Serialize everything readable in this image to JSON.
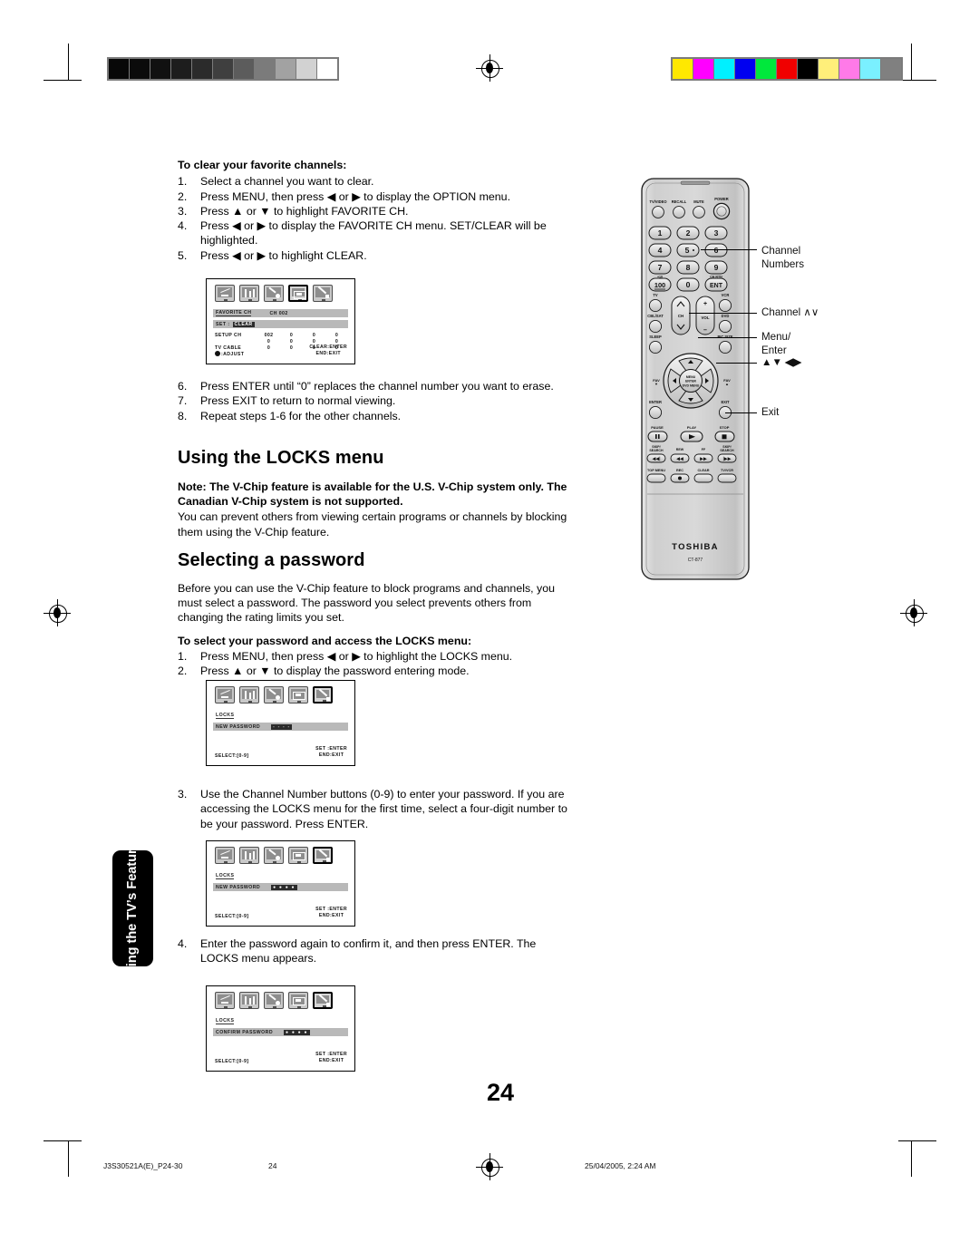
{
  "document": {
    "page_number": "24",
    "side_tab": "Using the TV’s Features",
    "footer": {
      "job_code": "J3S30521A(E)_P24-30",
      "page": "24",
      "timestamp": "25/04/2005, 2:24 AM"
    }
  },
  "sections": {
    "clear_favorites": {
      "heading": "To clear your favorite channels:",
      "steps": [
        {
          "n": "1.",
          "text": "Select a channel you want to clear."
        },
        {
          "n": "2.",
          "text": "Press MENU, then press ◀ or ▶ to display the OPTION menu."
        },
        {
          "n": "3.",
          "text": "Press ▲ or ▼ to highlight FAVORITE CH."
        },
        {
          "n": "4.",
          "text": "Press ◀ or ▶ to display the FAVORITE CH menu. SET/CLEAR will be highlighted."
        },
        {
          "n": "5.",
          "text": "Press ◀ or ▶ to highlight CLEAR."
        }
      ],
      "steps_after": [
        {
          "n": "6.",
          "text": "Press ENTER until “0” replaces the channel number you want to erase."
        },
        {
          "n": "7.",
          "text": "Press EXIT to return to normal viewing."
        },
        {
          "n": "8.",
          "text": "Repeat steps 1-6 for the other channels."
        }
      ]
    },
    "locks": {
      "heading": "Using the LOCKS menu",
      "note": "Note: The V-Chip feature is available for the U.S. V-Chip system only. The Canadian V-Chip system is not supported.",
      "body": "You can prevent others from viewing certain programs or channels by blocking them using the V-Chip feature."
    },
    "password": {
      "heading": "Selecting a password",
      "body": "Before you can use the V-Chip feature to block programs and channels, you must select a password. The password you select prevents others from changing the rating limits you set.",
      "subheading": "To select your password and access the LOCKS menu:",
      "steps": [
        {
          "n": "1.",
          "text": "Press MENU, then press ◀ or ▶ to highlight the LOCKS menu."
        },
        {
          "n": "2.",
          "text": "Press ▲ or ▼ to display the password entering mode."
        }
      ],
      "step3": {
        "n": "3.",
        "text": "Use the Channel Number buttons (0-9) to enter your password. If you are accessing the LOCKS menu for the first time, select a four-digit number to be your password. Press ENTER."
      },
      "step4": {
        "n": "4.",
        "text": "Enter the password again to confirm it, and then press ENTER. The LOCKS menu appears."
      }
    }
  },
  "osd_screens": {
    "favorite_ch": {
      "selected_icon_index": 3,
      "title": "FAVORITE CH",
      "channel_tag": "CH 002",
      "set_label": "SET :",
      "set_value": "CLEAR",
      "rows": [
        {
          "label": "SETUP CH",
          "values": [
            "002",
            "0",
            "0",
            "0"
          ]
        },
        {
          "label": "",
          "values": [
            "0",
            "0",
            "0",
            "0"
          ]
        },
        {
          "label": "TV CABLE",
          "values": [
            "0",
            "0",
            "0",
            "0"
          ]
        }
      ],
      "footer_left": ":ADJUST",
      "footer_right_1": "CLEAR:ENTER",
      "footer_right_2": "END:EXIT"
    },
    "locks_new_empty": {
      "selected_icon_index": 4,
      "title": "LOCKS",
      "field_label": "NEW PASSWORD",
      "field_value": "- - - -",
      "footer_left": "SELECT:[0-9]",
      "footer_right_1": "SET :ENTER",
      "footer_right_2": "END:EXIT"
    },
    "locks_new_filled": {
      "selected_icon_index": 4,
      "title": "LOCKS",
      "field_label": "NEW PASSWORD",
      "field_value": "● ● ● ●",
      "footer_left": "SELECT:[0-9]",
      "footer_right_1": "SET :ENTER",
      "footer_right_2": "END:EXIT"
    },
    "locks_confirm": {
      "selected_icon_index": 4,
      "title": "LOCKS",
      "field_label": "CONFIRM PASSWORD",
      "field_value": "● ● ● ●",
      "footer_left": "SELECT:[0-9]",
      "footer_right_1": "SET :ENTER",
      "footer_right_2": "END:EXIT"
    }
  },
  "remote": {
    "brand": "TOSHIBA",
    "model": "CT-877",
    "top_buttons": [
      "TV/VIDEO",
      "RECALL",
      "MUTE",
      "POWER"
    ],
    "keypad": [
      "1",
      "2",
      "3",
      "4",
      "5",
      "6",
      "7",
      "8",
      "9",
      "100",
      "0",
      "ENT"
    ],
    "keypad_sublabels": {
      "100": "+10",
      "ENT": "CH RTN"
    },
    "mode_buttons": [
      "TV",
      "VCR",
      "CBL/SAT",
      "DVD",
      "SLEEP",
      "PIC SIZE"
    ],
    "rocker_labels": {
      "ch": "CH",
      "vol": "VOL",
      "vol_plus": "+",
      "vol_minus": "–"
    },
    "center_labels": [
      "MENU",
      "ENTER",
      "DVD MENU"
    ],
    "fav_left": "FAV ▼",
    "fav_right": "FAV ▲",
    "enter_button": "ENTER",
    "exit_button": "EXIT",
    "transport_row1": [
      "PAUSE",
      "PLAY",
      "STOP"
    ],
    "transport_row2": [
      "SKIP/ SEARCH",
      "REW",
      "FF",
      "SKIP/ SEARCH"
    ],
    "transport_row3": [
      "TOP MENU",
      "REC",
      "CLEAR",
      "TV/VCR"
    ],
    "callouts": [
      {
        "id": "channel-numbers",
        "line1": "Channel",
        "line2": "Numbers"
      },
      {
        "id": "channel-up-down",
        "line1": "Channel ∧∨",
        "line2": ""
      },
      {
        "id": "menu-enter",
        "line1": "Menu/",
        "line2": "Enter"
      },
      {
        "id": "arrow-keys",
        "line1": "▲▼ ◀▶",
        "line2": ""
      },
      {
        "id": "exit",
        "line1": "Exit",
        "line2": ""
      }
    ]
  },
  "color_bars": {
    "grayscale": [
      "#080808",
      "#0b0b0b",
      "#111111",
      "#1d1d1d",
      "#2b2b2b",
      "#3f3f3f",
      "#5c5c5c",
      "#7b7b7b",
      "#a2a2a2",
      "#d2d2d2",
      "#ffffff"
    ],
    "colors": [
      "#ffe800",
      "#ff00ff",
      "#00f0ff",
      "#0000f0",
      "#00e83c",
      "#f00000",
      "#000000",
      "#ffef7a",
      "#ff7ae8",
      "#7af0ff",
      "#808080"
    ]
  }
}
